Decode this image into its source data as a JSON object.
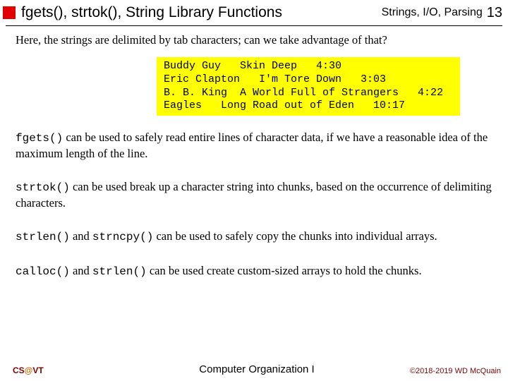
{
  "header": {
    "title": "fgets(), strtok(), String Library Functions",
    "breadcrumb": "Strings, I/O, Parsing",
    "page_number": "13"
  },
  "intro": "Here, the strings are delimited by tab characters; can we take advantage of that?",
  "code_lines": [
    "Buddy Guy   Skin Deep   4:30",
    "Eric Clapton   I'm Tore Down   3:03",
    "B. B. King  A World Full of Strangers   4:22",
    "Eagles   Long Road out of Eden   10:17"
  ],
  "paragraphs": [
    {
      "code": "fgets()",
      "rest": " can be used to safely read entire lines of character data, if we have a reasonable idea of the maximum length of the line."
    },
    {
      "code": "strtok()",
      "rest": " can be used break up a character string into chunks, based on the occurrence of delimiting characters."
    },
    {
      "code": "strlen()",
      "mid": " and ",
      "code2": "strncpy()",
      "rest": " can be used to safely copy the chunks into individual arrays."
    },
    {
      "code": "calloc()",
      "mid": " and ",
      "code2": "strlen()",
      "rest": " can be used create custom-sized arrays to hold the chunks."
    }
  ],
  "footer": {
    "left_prefix": "CS",
    "left_at": "@",
    "left_suffix": "VT",
    "center": "Computer Organization I",
    "right": "©2018-2019 WD McQuain"
  }
}
